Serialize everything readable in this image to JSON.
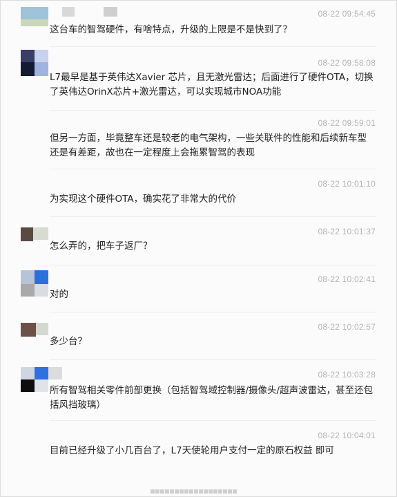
{
  "messages": [
    {
      "time": "08-22 09:54:45",
      "text": "这台车的智驾硬件，有啥特点，升级的上限是不是快到了？"
    },
    {
      "time": "08-22 09:58:08",
      "text": "L7最早是基于英伟达Xavier 芯片，且无激光雷达；后面进行了硬件OTA，切换了英伟达OrinX芯片+激光雷达，可以实现城市NOA功能"
    },
    {
      "time": "08-22 09:59:01",
      "text": "但另一方面，毕竟整车还是较老的电气架构，一些关联件的性能和后续新车型还是有差距，故也在一定程度上会拖累智驾的表现"
    },
    {
      "time": "08-22 10:01:10",
      "text": "为实现这个硬件OTA，确实花了非常大的代价"
    },
    {
      "time": "08-22 10:01:37",
      "text": "怎么弄的，把车子返厂？"
    },
    {
      "time": "08-22 10:02:41",
      "text": "对的"
    },
    {
      "time": "08-22 10:02:57",
      "text": "多少台？"
    },
    {
      "time": "08-22 10:03:28",
      "text": "所有智驾相关零件前部更换（包括智驾域控制器/摄像头/超声波雷达，甚至还包括风挡玻璃）"
    },
    {
      "time": "08-22 10:04:01",
      "text": "目前已经升级了小几百台了，L7天使轮用户支付一定的原石权益 即可"
    }
  ],
  "colors": {
    "time": "#b4b4b4",
    "text": "#222222",
    "background": "#fbfbfb",
    "separator": "#ececec"
  }
}
